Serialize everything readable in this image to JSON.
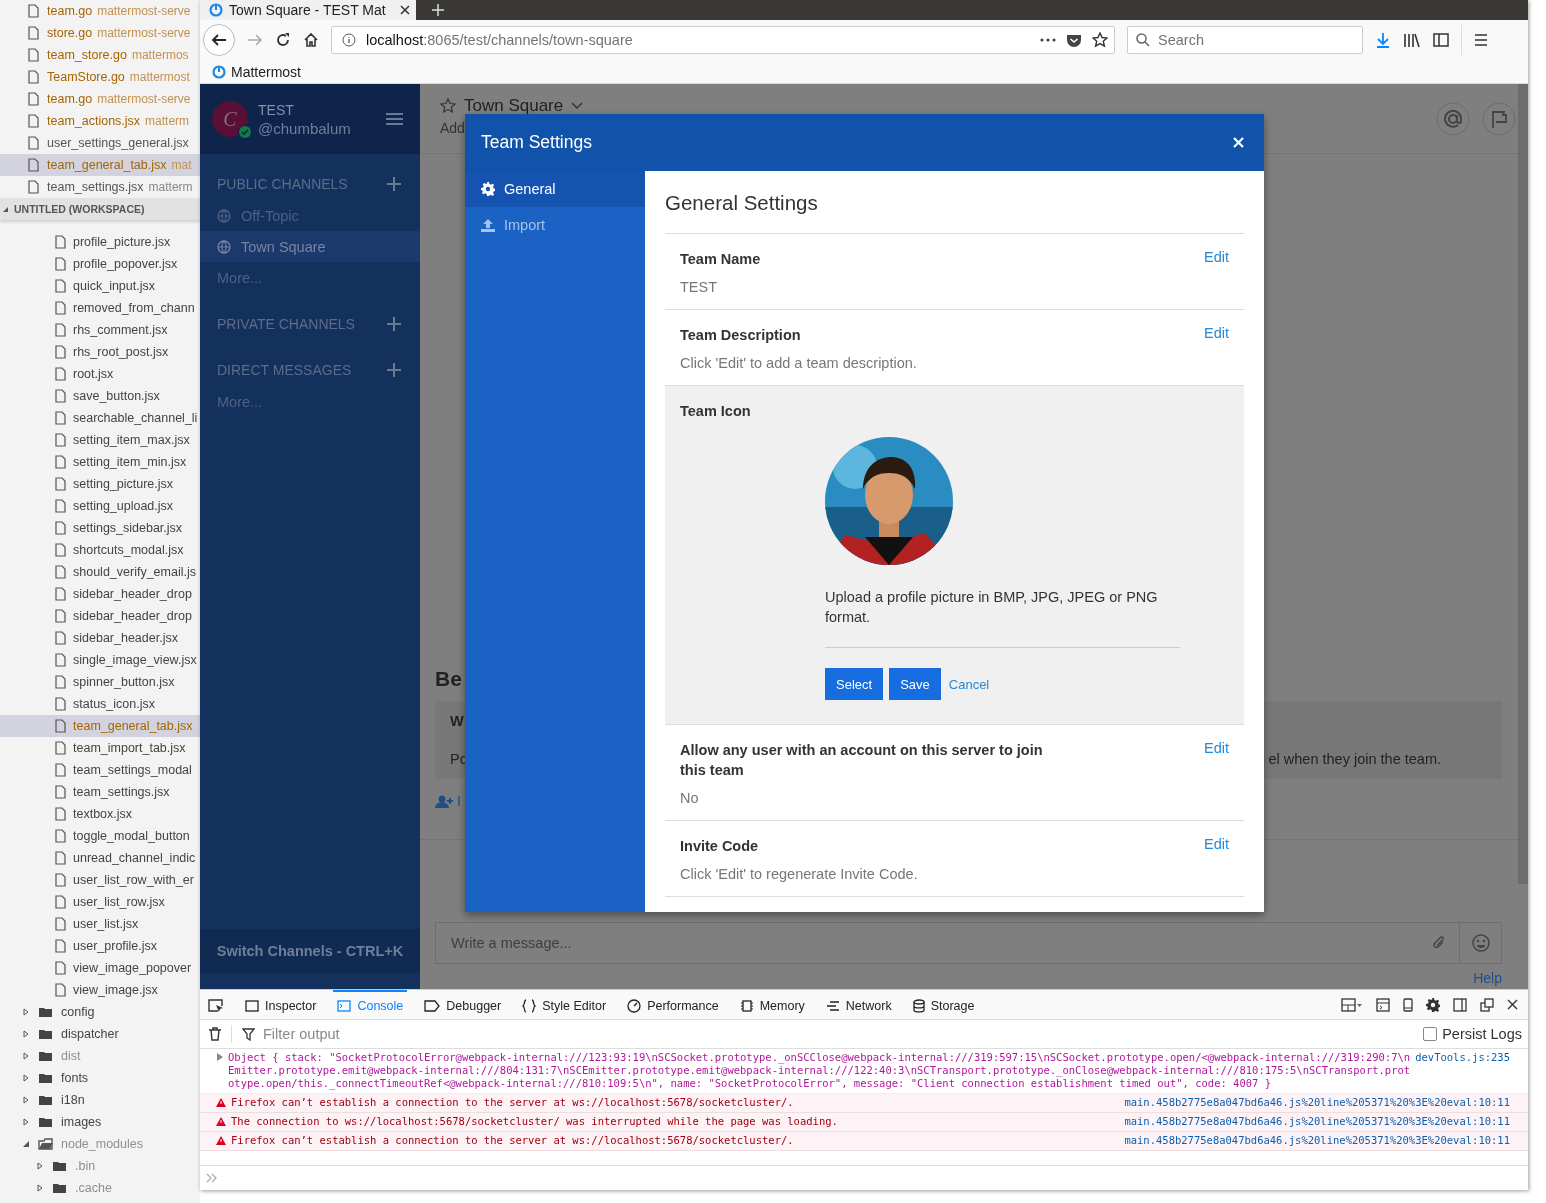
{
  "editor": {
    "open_editors": [
      {
        "name": "team.go",
        "path": "mattermost-serve",
        "modified": true,
        "selected": false
      },
      {
        "name": "store.go",
        "path": "mattermost-serve",
        "modified": true,
        "selected": false
      },
      {
        "name": "team_store.go",
        "path": "mattermos",
        "modified": true,
        "selected": false
      },
      {
        "name": "TeamStore.go",
        "path": "mattermost",
        "modified": true,
        "selected": false
      },
      {
        "name": "team.go",
        "path": "mattermost-serve",
        "modified": true,
        "selected": false
      },
      {
        "name": "team_actions.jsx",
        "path": "matterm",
        "modified": true,
        "selected": false
      },
      {
        "name": "user_settings_general.jsx",
        "modified": false,
        "selected": false
      },
      {
        "name": "team_general_tab.jsx",
        "path": "mat",
        "modified": true,
        "selected": true
      },
      {
        "name": "team_settings.jsx",
        "path": "matterm",
        "modified": false,
        "selected": false
      }
    ],
    "workspace_title": "UNTITLED (WORKSPACE)",
    "files": [
      {
        "name": "profile_picture.jsx",
        "selected": false
      },
      {
        "name": "profile_popover.jsx",
        "selected": false
      },
      {
        "name": "quick_input.jsx",
        "selected": false
      },
      {
        "name": "removed_from_chann",
        "selected": false
      },
      {
        "name": "rhs_comment.jsx",
        "selected": false
      },
      {
        "name": "rhs_root_post.jsx",
        "selected": false
      },
      {
        "name": "root.jsx",
        "selected": false
      },
      {
        "name": "save_button.jsx",
        "selected": false
      },
      {
        "name": "searchable_channel_li",
        "selected": false
      },
      {
        "name": "setting_item_max.jsx",
        "selected": false
      },
      {
        "name": "setting_item_min.jsx",
        "selected": false
      },
      {
        "name": "setting_picture.jsx",
        "selected": false
      },
      {
        "name": "setting_upload.jsx",
        "selected": false
      },
      {
        "name": "settings_sidebar.jsx",
        "selected": false
      },
      {
        "name": "shortcuts_modal.jsx",
        "selected": false
      },
      {
        "name": "should_verify_email.js",
        "selected": false
      },
      {
        "name": "sidebar_header_drop",
        "selected": false
      },
      {
        "name": "sidebar_header_drop",
        "selected": false
      },
      {
        "name": "sidebar_header.jsx",
        "selected": false
      },
      {
        "name": "single_image_view.jsx",
        "selected": false
      },
      {
        "name": "spinner_button.jsx",
        "selected": false
      },
      {
        "name": "status_icon.jsx",
        "selected": false
      },
      {
        "name": "team_general_tab.jsx",
        "selected": true
      },
      {
        "name": "team_import_tab.jsx",
        "selected": false
      },
      {
        "name": "team_settings_modal",
        "selected": false
      },
      {
        "name": "team_settings.jsx",
        "selected": false
      },
      {
        "name": "textbox.jsx",
        "selected": false
      },
      {
        "name": "toggle_modal_button",
        "selected": false
      },
      {
        "name": "unread_channel_indic",
        "selected": false
      },
      {
        "name": "user_list_row_with_er",
        "selected": false
      },
      {
        "name": "user_list_row.jsx",
        "selected": false
      },
      {
        "name": "user_list.jsx",
        "selected": false
      },
      {
        "name": "user_profile.jsx",
        "selected": false
      },
      {
        "name": "view_image_popover",
        "selected": false
      },
      {
        "name": "view_image.jsx",
        "selected": false
      }
    ],
    "folders": [
      {
        "name": "config",
        "expanded": false,
        "ignored": false
      },
      {
        "name": "dispatcher",
        "expanded": false,
        "ignored": false
      },
      {
        "name": "dist",
        "expanded": false,
        "ignored": true
      },
      {
        "name": "fonts",
        "expanded": false,
        "ignored": false
      },
      {
        "name": "i18n",
        "expanded": false,
        "ignored": false
      },
      {
        "name": "images",
        "expanded": false,
        "ignored": false
      },
      {
        "name": "node_modules",
        "expanded": true,
        "ignored": true,
        "children": [
          {
            "name": ".bin",
            "expanded": false,
            "ignored": true
          },
          {
            "name": ".cache",
            "expanded": false,
            "ignored": true
          }
        ]
      }
    ]
  },
  "browser": {
    "tab_title": "Town Square - TEST Mat",
    "url_host": "localhost",
    "url_path": ":8065/test/channels/town-square",
    "search_placeholder": "Search",
    "bookmark": "Mattermost"
  },
  "mattermost": {
    "avatar_letter": "C",
    "online": true,
    "team": "TEST",
    "user": "@chumbalum",
    "sections": [
      {
        "title": "PUBLIC CHANNELS",
        "channels": [
          {
            "name": "Off-Topic",
            "selected": false
          },
          {
            "name": "Town Square",
            "selected": true
          }
        ],
        "more": "More..."
      },
      {
        "title": "PRIVATE CHANNELS"
      },
      {
        "title": "DIRECT MESSAGES",
        "more": "More..."
      }
    ],
    "switch_channels": "Switch Channels - CTRL+K"
  },
  "channel_view": {
    "channel": "Town Square",
    "subtitle": "Add",
    "intro_heading": "Be",
    "intro_title": "W",
    "intro_text_start": "Po",
    "intro_text_end": "el when they join the team.",
    "invite_link": "I",
    "message_placeholder": "Write a message...",
    "help": "Help"
  },
  "modal": {
    "title": "Team Settings",
    "tabs": [
      {
        "label": "General",
        "kind": "gear",
        "selected": true
      },
      {
        "label": "Import",
        "kind": "upload",
        "selected": false
      }
    ],
    "heading": "General Settings",
    "settings": [
      {
        "kind": "text",
        "title": "Team Name",
        "value": "TEST",
        "action": "Edit"
      },
      {
        "kind": "text",
        "title": "Team Description",
        "value": "Click 'Edit' to add a team description.",
        "action": "Edit"
      },
      {
        "kind": "picture",
        "title": "Team Icon",
        "help": "Upload a profile picture in BMP, JPG, JPEG or PNG format.",
        "buttons": [
          {
            "label": "Select",
            "kind": "primary"
          },
          {
            "label": "Save",
            "kind": "primary"
          },
          {
            "label": "Cancel",
            "kind": "link"
          }
        ]
      },
      {
        "kind": "text",
        "title": "Allow any user with an account on this server to join this team",
        "value": "No",
        "action": "Edit"
      },
      {
        "kind": "text",
        "title": "Invite Code",
        "value": "Click 'Edit' to regenerate Invite Code.",
        "action": "Edit"
      }
    ]
  },
  "devtools": {
    "tabs": [
      {
        "label": "Inspector",
        "kind": "inspector",
        "selected": false
      },
      {
        "label": "Console",
        "kind": "console",
        "selected": true
      },
      {
        "label": "Debugger",
        "kind": "debugger",
        "selected": false
      },
      {
        "label": "Style Editor",
        "kind": "style",
        "selected": false
      },
      {
        "label": "Performance",
        "kind": "performance",
        "selected": false
      },
      {
        "label": "Memory",
        "kind": "memory",
        "selected": false
      },
      {
        "label": "Network",
        "kind": "network",
        "selected": false
      },
      {
        "label": "Storage",
        "kind": "storage",
        "selected": false
      }
    ],
    "filter_placeholder": "Filter output",
    "persist_logs": {
      "label": "Persist Logs",
      "checked": false
    },
    "messages": [
      {
        "kind": "log",
        "text": "Object { stack: \"SocketProtocolError@webpack-internal:///123:93:19\\nSCSocket.prototype._onSCClose@webpack-internal:///319:597:15\\nSCSocket.prototype.open/<@webpack-internal:///319:290:7\\nEmitter.prototype.emit@webpack-internal:///804:131:7\\nSCEmitter.prototype.emit@webpack-internal:///122:40:3\\nSCTransport.prototype._onClose@webpack-internal:///810:175:5\\nSCTransport.prototype.open/this._connectTimeoutRef<@webpack-internal:///810:109:5\\n\", name: \"SocketProtocolError\", message: \"Client connection establishment timed out\", code: 4007 }",
        "source": "devTools.js:235"
      },
      {
        "kind": "error",
        "text": "Firefox can’t establish a connection to the server at ws://localhost:5678/socketcluster/.",
        "source": "main.458b2775e8a047bd6a46.js%20line%205371%20%3E%20eval:10:11"
      },
      {
        "kind": "error",
        "text": "The connection to ws://localhost:5678/socketcluster/ was interrupted while the page was loading.",
        "source": "main.458b2775e8a047bd6a46.js%20line%205371%20%3E%20eval:10:11"
      },
      {
        "kind": "error",
        "text": "Firefox can’t establish a connection to the server at ws://localhost:5678/socketcluster/.",
        "source": "main.458b2775e8a047bd6a46.js%20line%205371%20%3E%20eval:10:11"
      }
    ]
  }
}
